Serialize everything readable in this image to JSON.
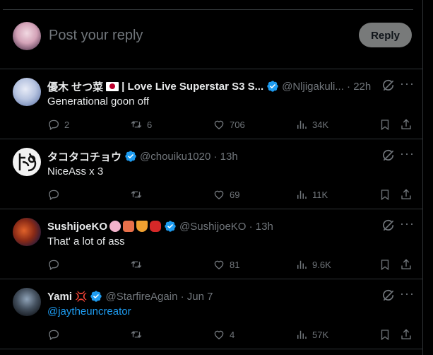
{
  "composer": {
    "placeholder": "Post your reply",
    "reply_label": "Reply"
  },
  "colors": {
    "background": "#000000",
    "text": "#e7e9ea",
    "muted": "#71767b",
    "link": "#1d9bf0",
    "verified": "#1d9bf0",
    "divider": "#2f3336"
  },
  "tweets": [
    {
      "name": "優木 せつ菜",
      "name_suffix": "| Love Live Superstar S3 S...",
      "handle_time": "@Nljigakuli... · 22h",
      "text": "Generational goon off",
      "replies": "2",
      "reposts": "6",
      "likes": "706",
      "views": "34K"
    },
    {
      "name": "タコタコチョウ",
      "handle_time": "@chouiku1020 · 13h",
      "text": "NiceAss x 3",
      "replies": "",
      "reposts": "",
      "likes": "69",
      "views": "11K"
    },
    {
      "name": "SushijoeKO",
      "handle_time": "@SushijoeKO · 13h",
      "text": "That' a lot of ass",
      "replies": "",
      "reposts": "",
      "likes": "81",
      "views": "9.6K"
    },
    {
      "name": "Yami",
      "handle_time": "@StarfireAgain · Jun 7",
      "text": "@jaytheuncreator",
      "replies": "",
      "reposts": "",
      "likes": "4",
      "views": "57K"
    }
  ],
  "icons": {
    "reply": "reply-icon",
    "repost": "repost-icon",
    "like": "heart-icon",
    "views": "views-icon",
    "bookmark": "bookmark-icon",
    "share": "share-icon",
    "grok": "grok-icon",
    "more": "more-icon",
    "verified": "verified-badge-icon"
  }
}
